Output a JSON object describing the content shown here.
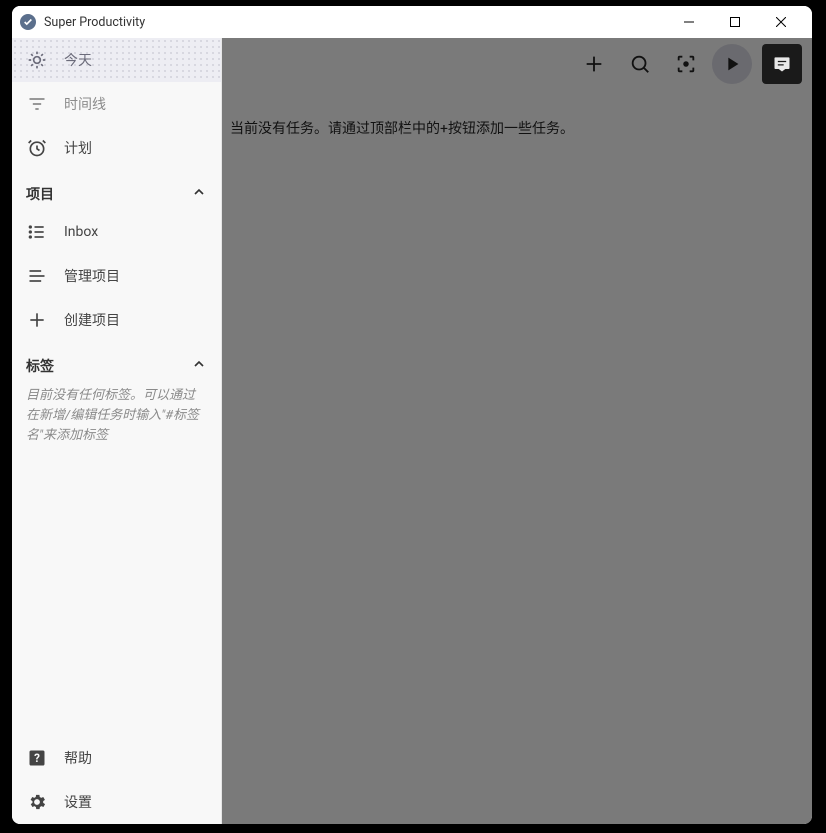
{
  "window": {
    "title": "Super Productivity"
  },
  "sidebar": {
    "nav": {
      "today": "今天",
      "timeline": "时间线",
      "scheduled": "计划"
    },
    "projects": {
      "header": "项目",
      "inbox": "Inbox",
      "manage": "管理项目",
      "create": "创建项目"
    },
    "tags": {
      "header": "标签",
      "empty": "目前没有任何标签。可以通过在新增/编辑任务时输入\"#标签名\"来添加标签"
    },
    "footer": {
      "help": "帮助",
      "settings": "设置"
    }
  },
  "main": {
    "empty_message": "当前没有任务。请通过顶部栏中的+按钮添加一些任务。"
  }
}
